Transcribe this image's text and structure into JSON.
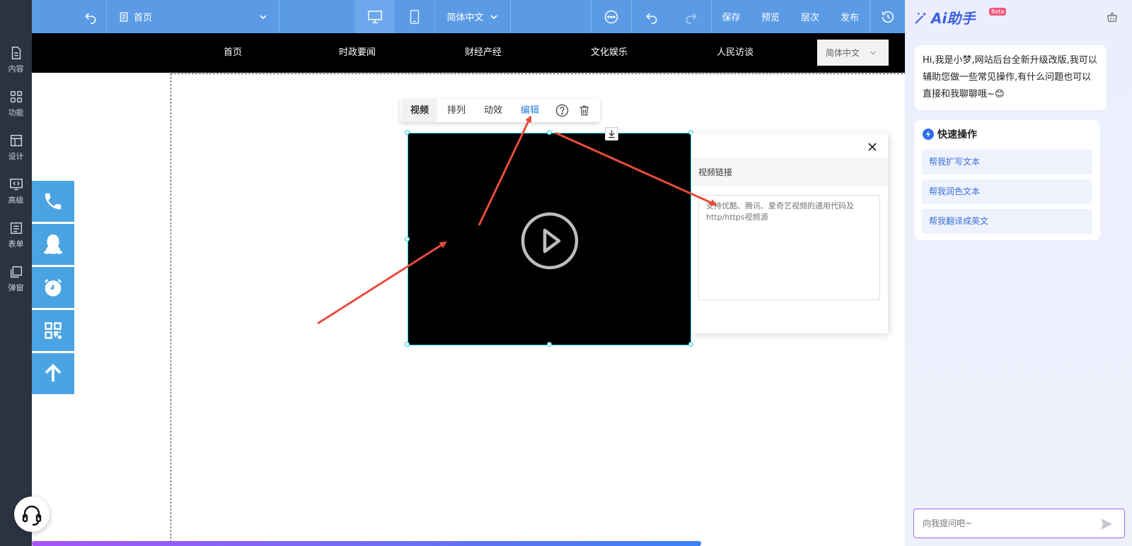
{
  "sidebar": {
    "items": [
      {
        "label": "内容",
        "icon": "document-icon"
      },
      {
        "label": "功能",
        "icon": "grid-icon"
      },
      {
        "label": "设计",
        "icon": "layout-icon"
      },
      {
        "label": "高级",
        "icon": "code-monitor-icon"
      },
      {
        "label": "表单",
        "icon": "form-icon"
      },
      {
        "label": "弹窗",
        "icon": "popup-icon"
      }
    ],
    "support_icon": "headset-icon"
  },
  "toolbar": {
    "page_name": "首页",
    "language": "简体中文",
    "save_label": "保存",
    "preview_label": "预览",
    "layers_label": "层次",
    "publish_label": "发布",
    "accent_color": "#5b9be6"
  },
  "site_nav": {
    "items": [
      "首页",
      "时政要闻",
      "财经产经",
      "文化娱乐",
      "人民访谈"
    ],
    "language_select": "简体中文"
  },
  "float_buttons": [
    "phone-icon",
    "qq-icon",
    "alarm-clock-icon",
    "qr-code-icon",
    "arrow-up-icon"
  ],
  "context_toolbar": {
    "items": [
      "视频",
      "排列",
      "动效",
      "编辑"
    ],
    "active": "视频",
    "highlight": "编辑"
  },
  "edit_panel": {
    "section_label": "视频链接",
    "placeholder": "支持优酷、腾讯、爱奇艺视频的通用代码及http/https视频源"
  },
  "ai_panel": {
    "title": "Ai助手",
    "badge": "Beta",
    "greeting": "Hi,我是小梦,网站后台全新升级改版,我可以辅助您做一些常见操作,有什么问题也可以直接和我聊聊哦~😊",
    "quick_title": "快速操作",
    "quick_actions": [
      "帮我扩写文本",
      "帮我润色文本",
      "帮我翻译成英文"
    ],
    "input_placeholder": "向我提问吧~"
  }
}
